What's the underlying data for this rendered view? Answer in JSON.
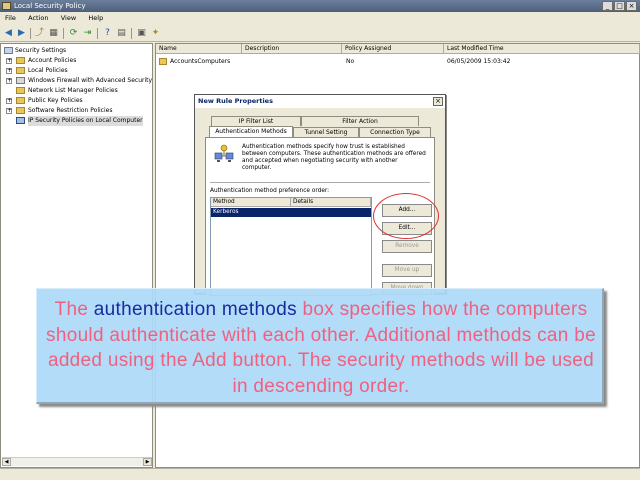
{
  "window": {
    "title": "Local Security Policy",
    "minimize": "_",
    "maximize": "□",
    "close": "×"
  },
  "menu": [
    "File",
    "Action",
    "View",
    "Help"
  ],
  "tree": {
    "root": "Security Settings",
    "items": [
      "Account Policies",
      "Local Policies",
      "Windows Firewall with Advanced Security",
      "Network List Manager Policies",
      "Public Key Policies",
      "Software Restriction Policies",
      "IP Security Policies on Local Computer"
    ]
  },
  "list": {
    "columns": [
      "Name",
      "Description",
      "Policy Assigned",
      "Last Modified Time"
    ],
    "rows": [
      {
        "name": "AccountsComputers",
        "description": "",
        "assigned": "No",
        "modified": "06/05/2009 15:03:42"
      }
    ]
  },
  "dialog": {
    "title": "New Rule Properties",
    "close": "×",
    "tabs_back": [
      "IP Filter List",
      "Filter Action"
    ],
    "tabs_front": [
      "Authentication Methods",
      "Tunnel Setting",
      "Connection Type"
    ],
    "description": "Authentication methods specify how trust is established between computers. These authentication methods are offered and accepted when negotiating security with another computer.",
    "group_label": "Authentication method preference order:",
    "table_headers": [
      "Method",
      "Details"
    ],
    "table_rows": [
      {
        "method": "Kerberos",
        "details": ""
      }
    ],
    "buttons": {
      "add": "Add...",
      "edit": "Edit...",
      "remove": "Remove",
      "move_up": "Move up",
      "move_down": "Move down"
    }
  },
  "overlay": {
    "text_before": "The ",
    "highlight": "authentication methods",
    "text_after": " box specifies how the computers should authenticate with each other. Additional methods can be added using the Add button. The security methods will be used in descending order."
  },
  "colors": {
    "overlay_text": "#f06080",
    "overlay_highlight": "#1a2aa0",
    "overlay_bg": "#add9f7",
    "selection": "#0a246a",
    "callout": "#e03030"
  }
}
